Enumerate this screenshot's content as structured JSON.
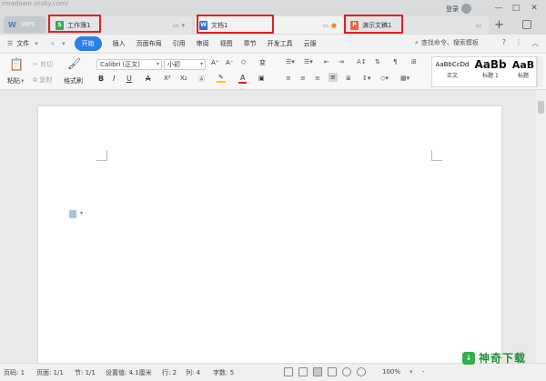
{
  "watermark": "rmadown.vcsky.com/",
  "tabs": {
    "home": {
      "label": "WPS"
    },
    "items": [
      {
        "label": "工作簿1",
        "icon": "spreadsheet-icon",
        "color": "#3aa757"
      },
      {
        "label": "文档1",
        "icon": "document-icon",
        "color": "#2b6fd8"
      },
      {
        "label": "演示文稿1",
        "icon": "presentation-icon",
        "color": "#e8663d"
      }
    ],
    "add": "+"
  },
  "account": {
    "login": "登录"
  },
  "window": {
    "minimize": "—",
    "maximize": "□",
    "close": "✕"
  },
  "menu": {
    "file": "文件",
    "items": [
      "开始",
      "插入",
      "页面布局",
      "引用",
      "审阅",
      "视图",
      "章节",
      "开发工具",
      "云服"
    ],
    "active": "开始",
    "search": "查找命令、搜索模板",
    "help": "?",
    "more": "⋮",
    "collapse": "︿"
  },
  "ribbon": {
    "paste": "粘贴",
    "cut": "剪切",
    "copy": "复制",
    "format_painter": "格式刷",
    "font_name": "Calibri (正文)",
    "font_size": "小初",
    "bold": "B",
    "italic": "I",
    "underline": "U",
    "strike": "A",
    "superscript": "X²",
    "subscript": "X₂",
    "grow": "A⁺",
    "shrink": "A⁻",
    "clear": "◇",
    "pinyin": "变",
    "styles": [
      {
        "preview": "AaBbCcDd",
        "label": "正文"
      },
      {
        "preview": "AaBb",
        "label": "标题 1"
      },
      {
        "preview": "AaB",
        "label": "标题"
      }
    ]
  },
  "status": {
    "page": "页码: 1",
    "pages": "页面: 1/1",
    "section": "节: 1/1",
    "setting": "设置值: 4.1厘米",
    "row": "行: 2",
    "col": "列: 4",
    "words": "字数: 5",
    "zoom": "100%",
    "zoom_minus": "-"
  },
  "brand": {
    "text": "神奇下载"
  },
  "colors": {
    "accent": "#2b7de9",
    "highlight": "#e02020"
  }
}
